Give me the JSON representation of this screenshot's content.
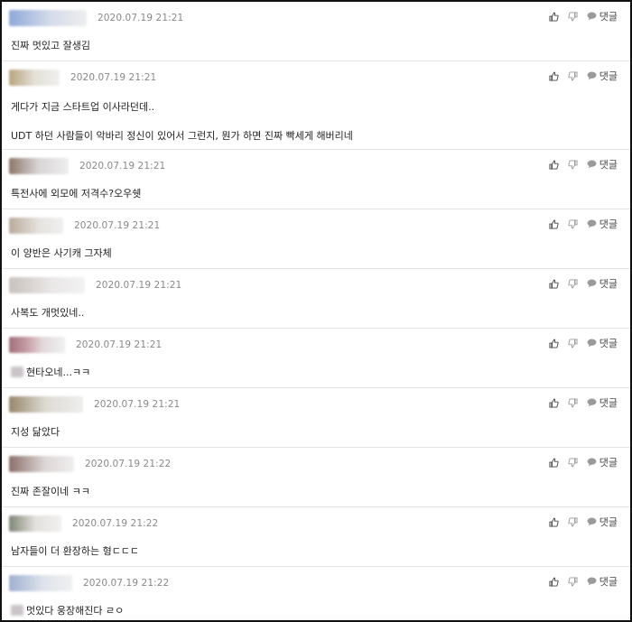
{
  "comments": [
    {
      "date": "2020.07.19 21:21",
      "lines": [
        "진짜 멋있고 잘생김"
      ],
      "reply_label": "댓글",
      "avatar": {
        "color1": "#8fa8d8",
        "color2": "#d6dcea"
      }
    },
    {
      "date": "2020.07.19 21:21",
      "lines": [
        "게다가 지금 스타트업 이사라던데..",
        "UDT 하던 사람들이 악바리 정신이 있어서 그런지, 뭔가 하면 진짜 빡세게 해버리네"
      ],
      "reply_label": "댓글",
      "avatar": {
        "color1": "#b8a47e",
        "color2": "#e3dfd6"
      }
    },
    {
      "date": "2020.07.19 21:21",
      "lines": [
        "특전사에 외모에 저격수?오우쉣"
      ],
      "reply_label": "댓글",
      "avatar": {
        "color1": "#8b7868",
        "color2": "#d9d5d8"
      }
    },
    {
      "date": "2020.07.19 21:21",
      "lines": [
        "이 양반은 사기캐 그자체"
      ],
      "reply_label": "댓글",
      "avatar": {
        "color1": "#b8ab9b",
        "color2": "#e6e2de"
      }
    },
    {
      "date": "2020.07.19 21:21",
      "lines": [
        "사복도 개멋있네.."
      ],
      "reply_label": "댓글",
      "avatar": {
        "color1": "#c9c1bd",
        "color2": "#e9e6e6"
      }
    },
    {
      "date": "2020.07.19 21:21",
      "lines": [
        "현타오네...ㅋㅋ"
      ],
      "reply_label": "댓글",
      "avatar": {
        "color1": "#a0707a",
        "color2": "#e2d8da"
      },
      "blurred_prefix": true
    },
    {
      "date": "2020.07.19 21:21",
      "lines": [
        "지성 닮았다"
      ],
      "reply_label": "댓글",
      "avatar": {
        "color1": "#96876c",
        "color2": "#dedbd4"
      }
    },
    {
      "date": "2020.07.19 21:22",
      "lines": [
        "진짜 존잘이네 ㅋㅋ"
      ],
      "reply_label": "댓글",
      "avatar": {
        "color1": "#8a6f6a",
        "color2": "#ddd6d5"
      }
    },
    {
      "date": "2020.07.19 21:22",
      "lines": [
        "남자들이 더 환장하는 형ㄷㄷㄷ"
      ],
      "reply_label": "댓글",
      "avatar": {
        "color1": "#7f8676",
        "color2": "#e3e0dc"
      }
    },
    {
      "date": "2020.07.19 21:22",
      "lines": [
        "멋있다 웅장해진다 ㄹㅇ"
      ],
      "reply_label": "댓글",
      "avatar": {
        "color1": "#9fb0d0",
        "color2": "#dfe3ec"
      },
      "blurred_prefix": true
    }
  ]
}
